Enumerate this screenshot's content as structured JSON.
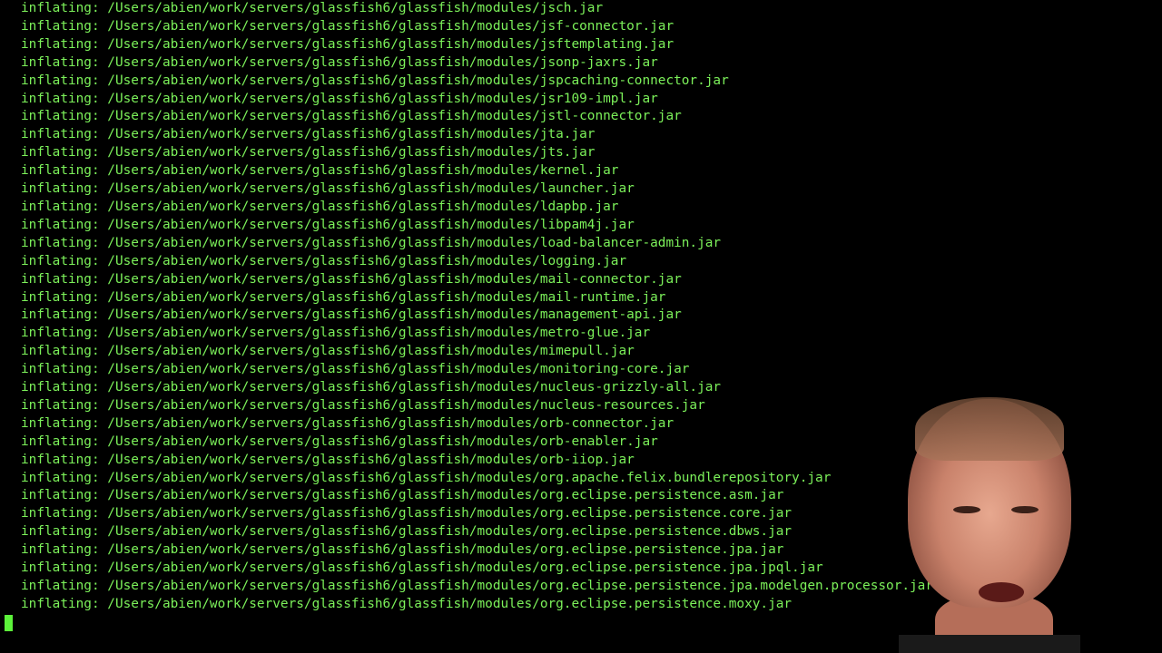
{
  "terminal": {
    "prefix": "inflating:",
    "base_path": "/Users/abien/work/servers/glassfish6/glassfish/modules/",
    "lines": [
      "inflating: /Users/abien/work/servers/glassfish6/glassfish/modules/jsch.jar",
      "inflating: /Users/abien/work/servers/glassfish6/glassfish/modules/jsf-connector.jar",
      "inflating: /Users/abien/work/servers/glassfish6/glassfish/modules/jsftemplating.jar",
      "inflating: /Users/abien/work/servers/glassfish6/glassfish/modules/jsonp-jaxrs.jar",
      "inflating: /Users/abien/work/servers/glassfish6/glassfish/modules/jspcaching-connector.jar",
      "inflating: /Users/abien/work/servers/glassfish6/glassfish/modules/jsr109-impl.jar",
      "inflating: /Users/abien/work/servers/glassfish6/glassfish/modules/jstl-connector.jar",
      "inflating: /Users/abien/work/servers/glassfish6/glassfish/modules/jta.jar",
      "inflating: /Users/abien/work/servers/glassfish6/glassfish/modules/jts.jar",
      "inflating: /Users/abien/work/servers/glassfish6/glassfish/modules/kernel.jar",
      "inflating: /Users/abien/work/servers/glassfish6/glassfish/modules/launcher.jar",
      "inflating: /Users/abien/work/servers/glassfish6/glassfish/modules/ldapbp.jar",
      "inflating: /Users/abien/work/servers/glassfish6/glassfish/modules/libpam4j.jar",
      "inflating: /Users/abien/work/servers/glassfish6/glassfish/modules/load-balancer-admin.jar",
      "inflating: /Users/abien/work/servers/glassfish6/glassfish/modules/logging.jar",
      "inflating: /Users/abien/work/servers/glassfish6/glassfish/modules/mail-connector.jar",
      "inflating: /Users/abien/work/servers/glassfish6/glassfish/modules/mail-runtime.jar",
      "inflating: /Users/abien/work/servers/glassfish6/glassfish/modules/management-api.jar",
      "inflating: /Users/abien/work/servers/glassfish6/glassfish/modules/metro-glue.jar",
      "inflating: /Users/abien/work/servers/glassfish6/glassfish/modules/mimepull.jar",
      "inflating: /Users/abien/work/servers/glassfish6/glassfish/modules/monitoring-core.jar",
      "inflating: /Users/abien/work/servers/glassfish6/glassfish/modules/nucleus-grizzly-all.jar",
      "inflating: /Users/abien/work/servers/glassfish6/glassfish/modules/nucleus-resources.jar",
      "inflating: /Users/abien/work/servers/glassfish6/glassfish/modules/orb-connector.jar",
      "inflating: /Users/abien/work/servers/glassfish6/glassfish/modules/orb-enabler.jar",
      "inflating: /Users/abien/work/servers/glassfish6/glassfish/modules/orb-iiop.jar",
      "inflating: /Users/abien/work/servers/glassfish6/glassfish/modules/org.apache.felix.bundlerepository.jar",
      "inflating: /Users/abien/work/servers/glassfish6/glassfish/modules/org.eclipse.persistence.asm.jar",
      "inflating: /Users/abien/work/servers/glassfish6/glassfish/modules/org.eclipse.persistence.core.jar",
      "inflating: /Users/abien/work/servers/glassfish6/glassfish/modules/org.eclipse.persistence.dbws.jar",
      "inflating: /Users/abien/work/servers/glassfish6/glassfish/modules/org.eclipse.persistence.jpa.jar",
      "inflating: /Users/abien/work/servers/glassfish6/glassfish/modules/org.eclipse.persistence.jpa.jpql.jar",
      "inflating: /Users/abien/work/servers/glassfish6/glassfish/modules/org.eclipse.persistence.jpa.modelgen.processor.jar",
      "inflating: /Users/abien/work/servers/glassfish6/glassfish/modules/org.eclipse.persistence.moxy.jar"
    ]
  },
  "colors": {
    "background": "#000000",
    "text": "#7cf15a",
    "cursor": "#5cf23a"
  },
  "overlay": {
    "icon": "presenter-webcam"
  }
}
